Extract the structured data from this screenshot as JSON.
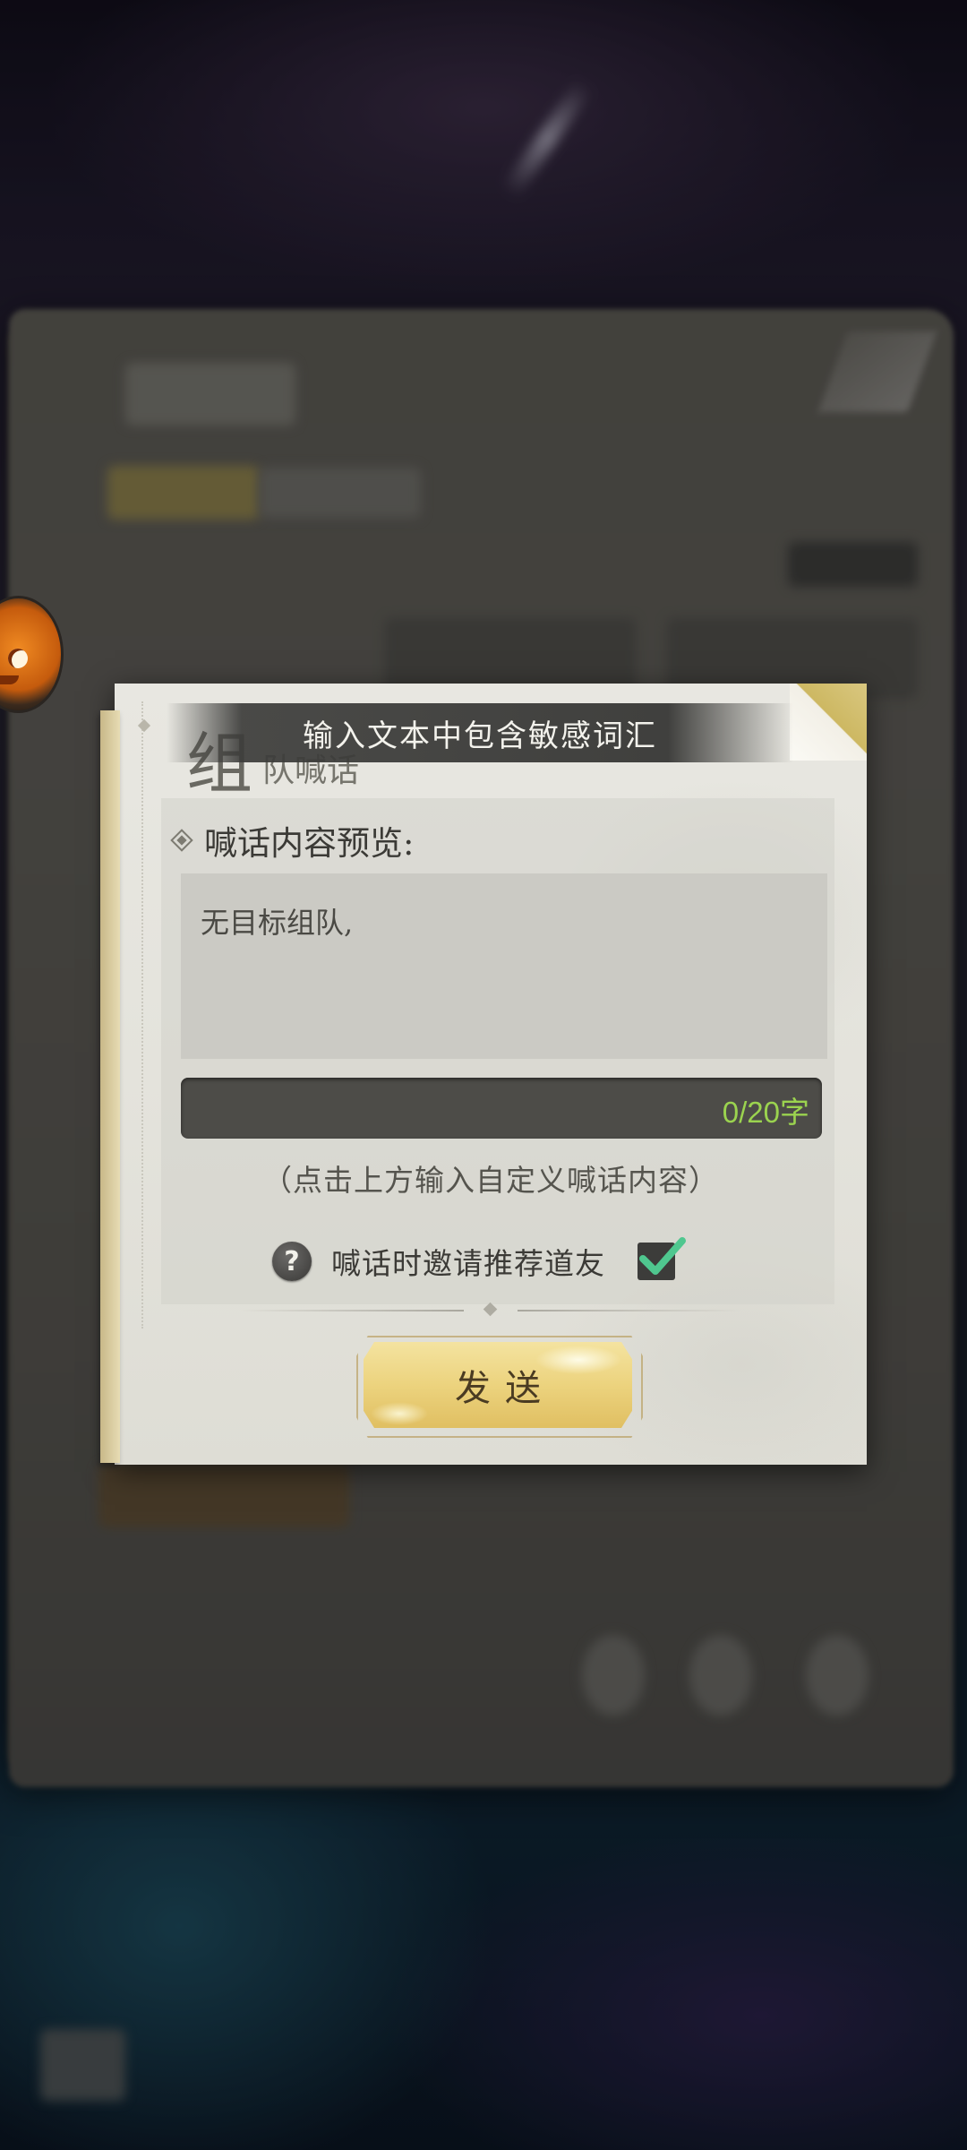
{
  "dialog": {
    "title_big": "组",
    "title_small": "队喊话",
    "preview_label": "喊话内容预览:",
    "preview_text": "无目标组队,",
    "char_count": "0/20字",
    "hint": "（点击上方输入自定义喊话内容）",
    "invite_label": "喊话时邀请推荐道友",
    "invite_checked": true,
    "send_label": "发送"
  },
  "warning": {
    "text": "输入文本中包含敏感词汇"
  },
  "icons": [
    "help-icon",
    "checkmark-icon",
    "avatar"
  ],
  "colors": {
    "count_text": "#9bd34f",
    "send_button": "#ecd37e",
    "banner_bg": "#373735"
  }
}
